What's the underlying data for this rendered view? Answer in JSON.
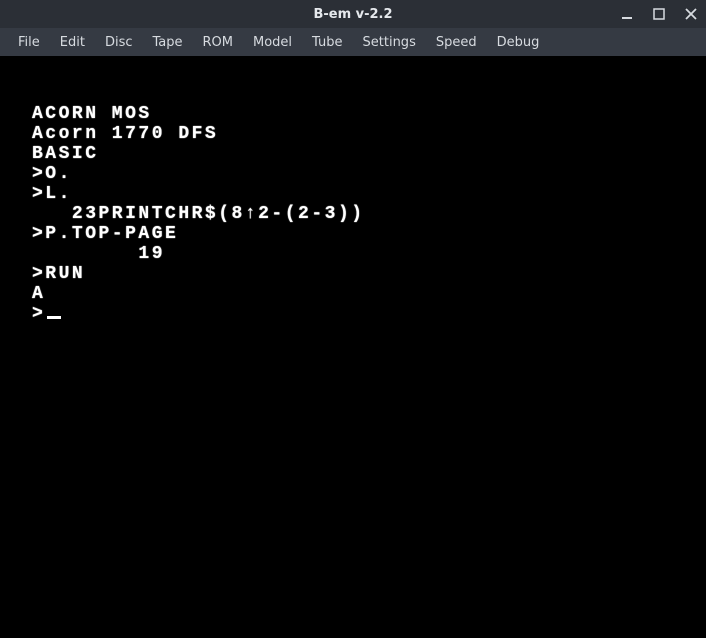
{
  "window": {
    "title": "B-em v-2.2"
  },
  "menu": {
    "items": [
      "File",
      "Edit",
      "Disc",
      "Tape",
      "ROM",
      "Model",
      "Tube",
      "Settings",
      "Speed",
      "Debug"
    ]
  },
  "terminal": {
    "lines": [
      "ACORN MOS",
      "",
      "Acorn 1770 DFS",
      "",
      "BASIC",
      "",
      ">O.",
      ">L.",
      "   23PRINTCHR$(8↑2-(2-3))",
      ">P.TOP-PAGE",
      "        19",
      ">RUN",
      "A",
      ">"
    ]
  }
}
